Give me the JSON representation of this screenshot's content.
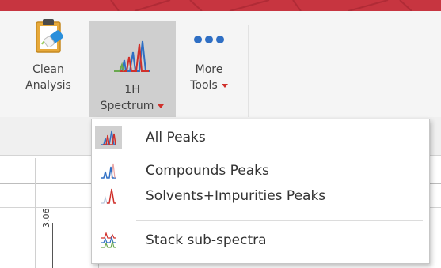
{
  "ribbon": {
    "clean_analysis": {
      "line1": "Clean",
      "line2": "Analysis",
      "icon": "clipboard-eraser-icon"
    },
    "spectrum_1h": {
      "line1": "1H",
      "line2": "Spectrum",
      "icon": "nmr-peaks-icon"
    },
    "more_tools": {
      "line1": "More",
      "line2": "Tools",
      "icon": "three-dots-icon"
    }
  },
  "spectrum_menu": {
    "items": [
      {
        "label": "All Peaks",
        "icon": "all-peaks-icon"
      },
      {
        "label": "Compounds Peaks",
        "icon": "compounds-peaks-icon"
      },
      {
        "label": "Solvents+Impurities Peaks",
        "icon": "solvents-impurities-peaks-icon"
      },
      {
        "label": "Stack sub-spectra",
        "icon": "stack-sub-spectra-icon"
      }
    ]
  },
  "axis": {
    "tick_label": "3.06"
  },
  "colors": {
    "titlebar": "#c73540",
    "accent_red": "#d0302b",
    "accent_blue": "#2f6fc4",
    "selected_bg": "#cfcfcf"
  }
}
